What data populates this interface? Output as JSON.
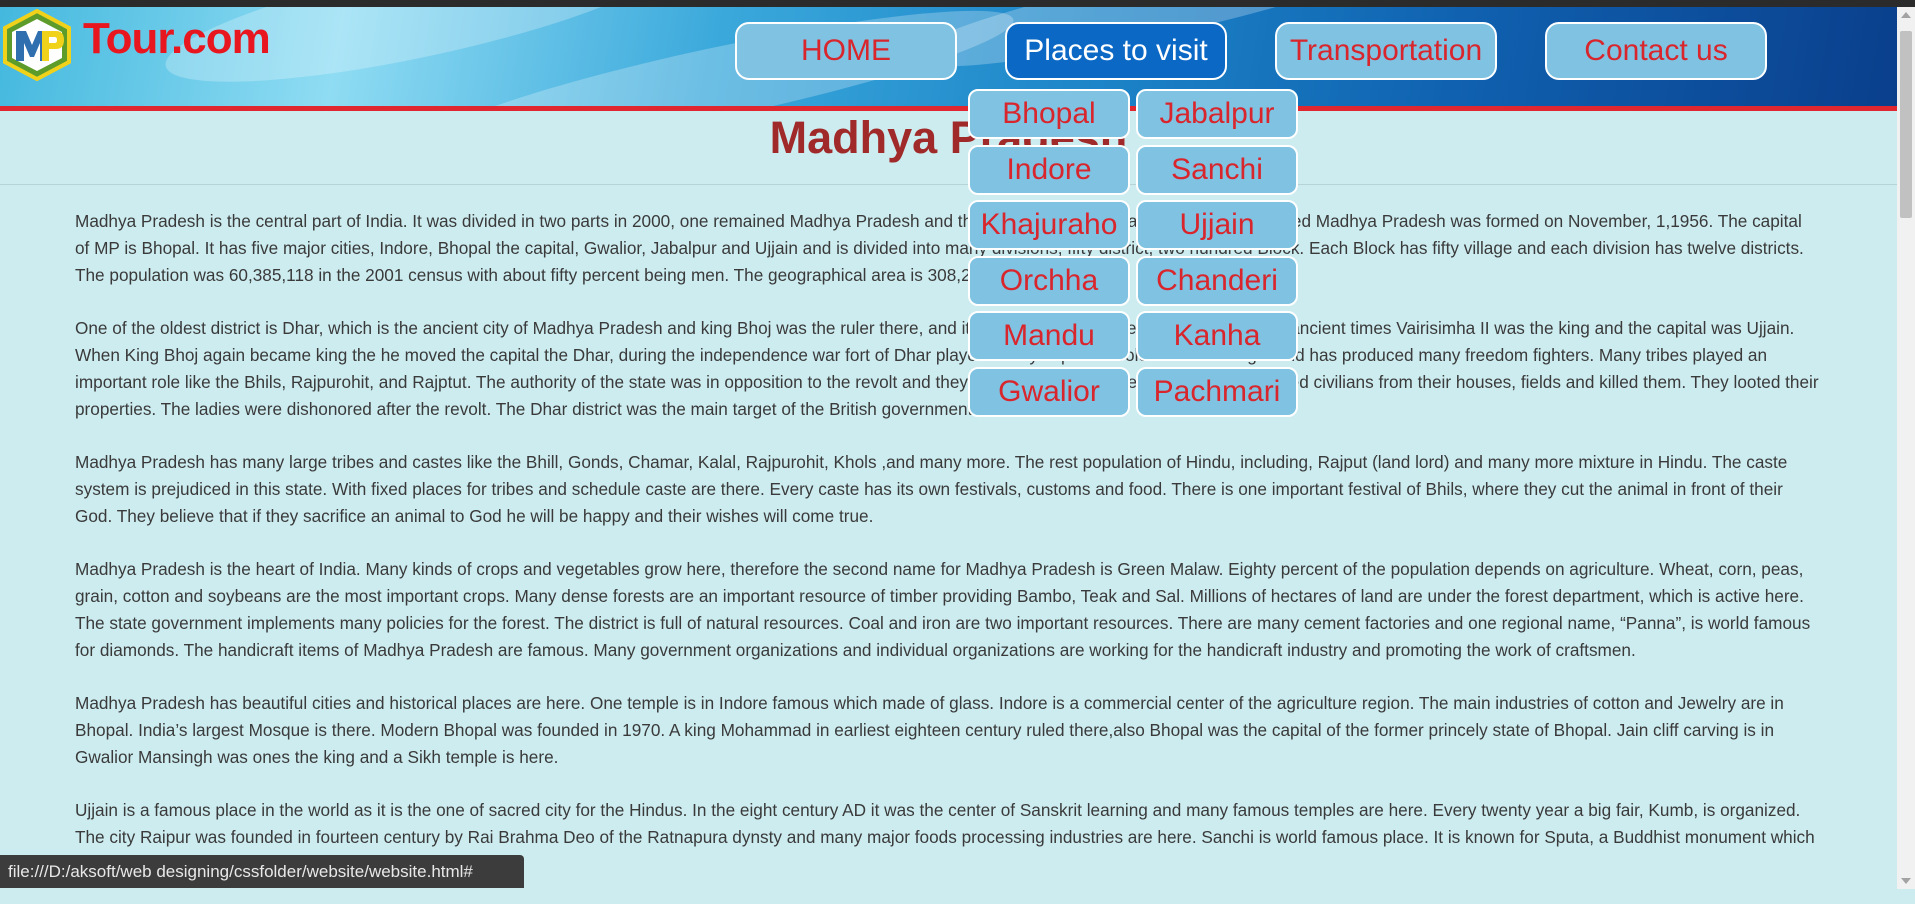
{
  "header": {
    "logo_text": "Tour.com",
    "logo_mark_letters": "MP",
    "nav": [
      "HOME",
      "Places to visit",
      "Transportation",
      "Contact us"
    ],
    "active_nav": "Places to visit",
    "dropdown": [
      "Bhopal",
      "Jabalpur",
      "Indore",
      "Sanchi",
      "Khajuraho",
      "Ujjain",
      "Orchha",
      "Chanderi",
      "Mandu",
      "Kanha",
      "Gwalior",
      "Pachmari"
    ]
  },
  "page_title": "Madhya Pradesh",
  "paragraphs": [
    "Madhya Pradesh is the central part of India. It was divided in two parts in 2000, one remained Madhya Pradesh and the other became Chhattisgarh. The undivided Madhya Pradesh was formed on November, 1,1956. The capital of MP is Bhopal. It has five major cities, Indore, Bhopal the capital, Gwalior, Jabalpur and Ujjain and is divided into many divisions, fifty district, two hundred Block. Each Block has fifty village and each division has twelve districts. The population was 60,385,118 in the 2001 census with about fifty percent being men. The geographical area is 308,245 sq km.",
    "One of the oldest district is Dhar, which is the ancient city of Madhya Pradesh and king Bhoj was the ruler there, and it was the capital of the Paramara kings. In ancient times Vairisimha II was the king and the capital was Ujjain. When King Bhoj again became king the he moved the capital the Dhar, during the independence war fort of Dhar played a very important role in freedom fight and has produced many freedom fighters. Many tribes played an important role like the Bhils, Rajpurohit, and Rajptut. The authority of the state was in opposition to the revolt and they were very cruel to the people. They dragged civilians from their houses, fields and killed them. They looted their properties. The ladies were dishonored after the revolt. The Dhar district was the main target of the British government.",
    "Madhya Pradesh has many large tribes and castes like the Bhill, Gonds, Chamar, Kalal, Rajpurohit, Khols ,and many more. The rest population of Hindu, including, Rajput (land lord) and many more mixture in Hindu. The caste system is prejudiced in this state. With fixed places for tribes and schedule caste are there. Every caste has its own festivals, customs and food. There is one important festival of Bhils, where they cut the animal in front of their God. They believe that if they sacrifice an animal to God he will be happy and their wishes will come true.",
    "Madhya Pradesh is the heart of India. Many kinds of crops and vegetables grow here, therefore the second name for Madhya Pradesh is Green Malaw. Eighty percent of the population depends on agriculture. Wheat, corn, peas, grain, cotton and soybeans are the most important crops. Many dense forests are an important resource of timber providing Bambo, Teak and Sal. Millions of hectares of land are under the forest department, which is active here. The state government implements many policies for the forest. The district is full of natural resources. Coal and iron are two important resources. There are many cement factories and one regional name, “Panna”, is world famous for diamonds. The handicraft items of Madhya Pradesh are famous. Many government organizations and individual organizations are working for the handicraft industry and promoting the work of craftsmen.",
    "Madhya Pradesh has beautiful cities and historical places are here. One temple is in Indore famous which made of glass. Indore is a commercial center of the agriculture region. The main industries of cotton and Jewelry are in Bhopal. India’s largest Mosque is there. Modern Bhopal was founded in 1970. A king Mohammad in earliest eighteen century ruled there,also Bhopal was the capital of the former princely state of Bhopal. Jain cliff carving is in Gwalior Mansingh was ones the king and a Sikh temple is here.",
    "Ujjain is a famous place in the world as it is the one of sacred city for the Hindus. In the eight century AD it was the center of Sanskrit learning and many famous temples are here. Every twenty year a big fair, Kumb, is organized. The city Raipur was founded in fourteen century by Rai Brahma Deo of the Ratnapura dynsty and many major foods processing industries are here. Sanchi is world famous place. It is known for Sputa, a Buddhist monument which was originally built by the Mauryan Emperor Ashoka."
  ],
  "status_url": "file:///D:/aksoft/web designing/cssfolder/website/website.html#",
  "colors": {
    "accent_red": "#d9252c",
    "nav_bg": "#7fc2e2",
    "nav_active_bg": "#0b68c5",
    "title": "#a02a2a",
    "page_bg": "#cdecf0"
  }
}
